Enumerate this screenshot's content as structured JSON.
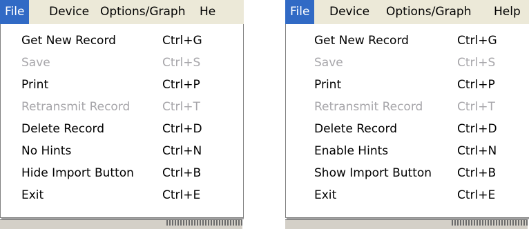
{
  "left": {
    "menubar": [
      "File",
      "Device",
      "Options/Graph",
      "He"
    ],
    "items": [
      {
        "label": "Get New Record",
        "shortcut": "Ctrl+G",
        "enabled": true
      },
      {
        "label": "Save",
        "shortcut": "Ctrl+S",
        "enabled": false
      },
      {
        "label": "Print",
        "shortcut": "Ctrl+P",
        "enabled": true
      },
      {
        "label": "Retransmit Record",
        "shortcut": "Ctrl+T",
        "enabled": false
      },
      {
        "label": "Delete Record",
        "shortcut": "Ctrl+D",
        "enabled": true
      },
      {
        "label": "No Hints",
        "shortcut": "Ctrl+N",
        "enabled": true
      },
      {
        "label": "Hide Import Button",
        "shortcut": "Ctrl+B",
        "enabled": true
      },
      {
        "label": "Exit",
        "shortcut": "Ctrl+E",
        "enabled": true
      }
    ]
  },
  "right": {
    "menubar": [
      "File",
      "Device",
      "Options/Graph",
      "Help"
    ],
    "items": [
      {
        "label": "Get New Record",
        "shortcut": "Ctrl+G",
        "enabled": true
      },
      {
        "label": "Save",
        "shortcut": "Ctrl+S",
        "enabled": false
      },
      {
        "label": "Print",
        "shortcut": "Ctrl+P",
        "enabled": true
      },
      {
        "label": "Retransmit Record",
        "shortcut": "Ctrl+T",
        "enabled": false
      },
      {
        "label": "Delete Record",
        "shortcut": "Ctrl+D",
        "enabled": true
      },
      {
        "label": "Enable Hints",
        "shortcut": "Ctrl+N",
        "enabled": true
      },
      {
        "label": "Show Import Button",
        "shortcut": "Ctrl+B",
        "enabled": true
      },
      {
        "label": "Exit",
        "shortcut": "Ctrl+E",
        "enabled": true
      }
    ]
  },
  "colors": {
    "menubar_bg": "#ece9d8",
    "highlight": "#316ac5",
    "disabled_text": "#a7a6aa"
  }
}
